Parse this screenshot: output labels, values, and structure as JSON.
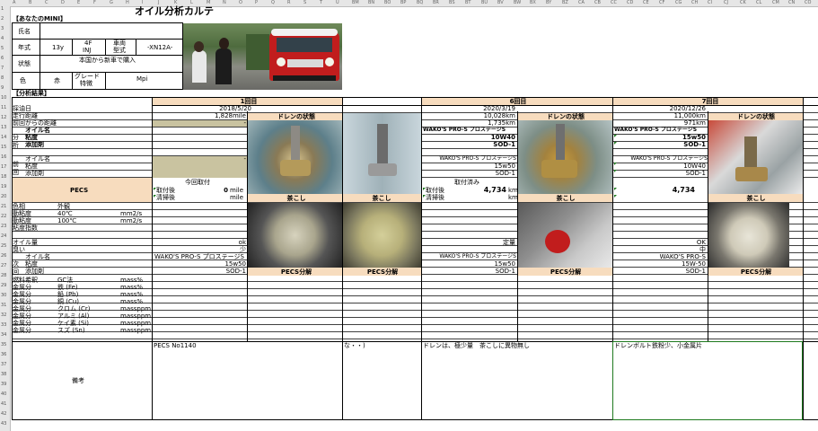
{
  "col_letters": [
    "A",
    "B",
    "C",
    "D",
    "E",
    "F",
    "G",
    "H",
    "I",
    "J",
    "K",
    "L",
    "M",
    "N",
    "O",
    "P",
    "Q",
    "R",
    "S",
    "T",
    "U",
    "BM",
    "BN",
    "BO",
    "BP",
    "BQ",
    "BR",
    "BS",
    "BT",
    "BU",
    "BV",
    "BW",
    "BX",
    "BY",
    "BZ",
    "CA",
    "CB",
    "CC",
    "CD",
    "CE",
    "CF",
    "CG",
    "CH",
    "CI",
    "CJ",
    "CK",
    "CL",
    "CM",
    "CN",
    "CO"
  ],
  "row_numbers": [
    "1",
    "2",
    "3",
    "4",
    "5",
    "6",
    "7",
    "8",
    "9",
    "10",
    "11",
    "12",
    "13",
    "14",
    "15",
    "16",
    "17",
    "18",
    "19",
    "20",
    "21",
    "22",
    "23",
    "24",
    "25",
    "26",
    "27",
    "28",
    "29",
    "30",
    "31",
    "32",
    "33",
    "34",
    "35",
    "36",
    "37",
    "38",
    "39",
    "40",
    "41",
    "42",
    "43"
  ],
  "title": "オイル分析カルテ",
  "section_mini": "【あなたのMINI】",
  "car": {
    "name_label": "氏名",
    "year_label": "年式",
    "year_value": "13y",
    "engine_top": "4F",
    "engine_bot": "INJ",
    "type_label_top": "車両",
    "type_label_bot": "型式",
    "type_value": "-XN12A-",
    "status_label": "状態",
    "status_value": "本国から新車で購入",
    "color_label": "色",
    "color_value": "赤",
    "grade_label_top": "グレード",
    "grade_label_bot": "特徴",
    "grade_value": "Mpi"
  },
  "section_results": "【分析結果】",
  "labels": {
    "date": "採油日",
    "mileage": "走行距離",
    "prev_distance": "前回からの距離",
    "analysis_group": "分析",
    "oil_name": "オイル名",
    "viscosity": "粘度",
    "additive": "添加剤",
    "prev_group": "前回",
    "pecs": "PECS",
    "color": "色相",
    "appearance": "外観",
    "kv40": "動粘度",
    "kv40_temp": "40℃",
    "kv100": "動粘度",
    "kv100_temp": "100℃",
    "unit_mm2s": "mm2/s",
    "vi": "粘度指数",
    "oil_qty": "オイル量",
    "odor": "臭い",
    "next_group": "次回",
    "fuel": "燃料希釈",
    "gc": "GC法",
    "mass": "mass%",
    "metal": "金属分",
    "fe": "鉄 (Fe)",
    "pb": "鉛 (Pb)",
    "cu": "銅 (Cu)",
    "cr": "クロム (Cr)",
    "al": "アルミ (Al)",
    "si": "ケイ素 (Si)",
    "sn": "スズ (Sn)",
    "massppm": "massppm",
    "remarks": "備考"
  },
  "pecs_block": {
    "current": "今回取付",
    "attach": "取付後",
    "clean": "清掃後"
  },
  "col1": {
    "header": "1回目",
    "date": "2018/5/20",
    "mileage": "1,828mile",
    "prev": "-",
    "prev_oil": "-",
    "pecs_attach_val": "0",
    "pecs_attach_unit": "mile",
    "pecs_clean_unit": "mile",
    "qty": "ok",
    "odor": "少",
    "next_oil": "WAKO'S PRO-S プロステージS",
    "next_visc": "15w50",
    "next_add": "SOD-1",
    "remarks": "PECS No1140",
    "drain_label": "ドレンの状態",
    "strainer_label": "茶こし",
    "pecs_label": "PECS分解"
  },
  "col2": {
    "drain_label": "",
    "strainer_label": "茶こし",
    "pecs_label": "PECS分解",
    "remarks": "な・・)"
  },
  "col6": {
    "header": "6回目",
    "date": "2020/3/19",
    "mileage": "10,028km",
    "prev": "1,735km",
    "oil": "WAKO'S PRO-S プロステージS",
    "visc": "10W40",
    "add": "SOD-1",
    "prev_oil": "WAKO'S PRO-S プロステージS",
    "prev_visc": "15w50",
    "prev_add": "SOD-1",
    "pecs_current": "取付済み",
    "pecs_attach_val": "4,734",
    "pecs_unit": "km",
    "qty": "定量",
    "next_oil": "WAKO'S PRO-S プロステージS",
    "next_visc": "15w50",
    "next_add": "SOD-1",
    "remarks": "ドレンは、極少量　茶こしに異物無し",
    "drain_label": "ドレンの状態",
    "strainer_label": "茶こし",
    "pecs_label": "PECS分解"
  },
  "col7": {
    "header": "7回目",
    "date": "2020/12/26",
    "mileage": "11,000km",
    "prev": "971km",
    "oil": "WAKO'S PRO-S プロステージS",
    "visc": "15w50",
    "add": "SOD-1",
    "prev_oil": "WAKO'S PRO-S プロステージS",
    "prev_visc": "10W40",
    "prev_add": "SOD-1",
    "pecs_attach_val": "4,734",
    "qty": "OK",
    "odor": "中",
    "next_oil": "WAKO'S PRO-S",
    "next_visc": "15W-50",
    "next_add": "SOD-1",
    "remarks": "ドレンボルト鉄粉少、小金属片",
    "drain_label": "ドレンの状態",
    "strainer_label": "茶こし",
    "pecs_label": "PECS分解"
  },
  "colors": {
    "beige": "#f7dcbe",
    "olive": "#c9c3a0",
    "grid": "#000000",
    "selection": "#1e7a1e"
  }
}
